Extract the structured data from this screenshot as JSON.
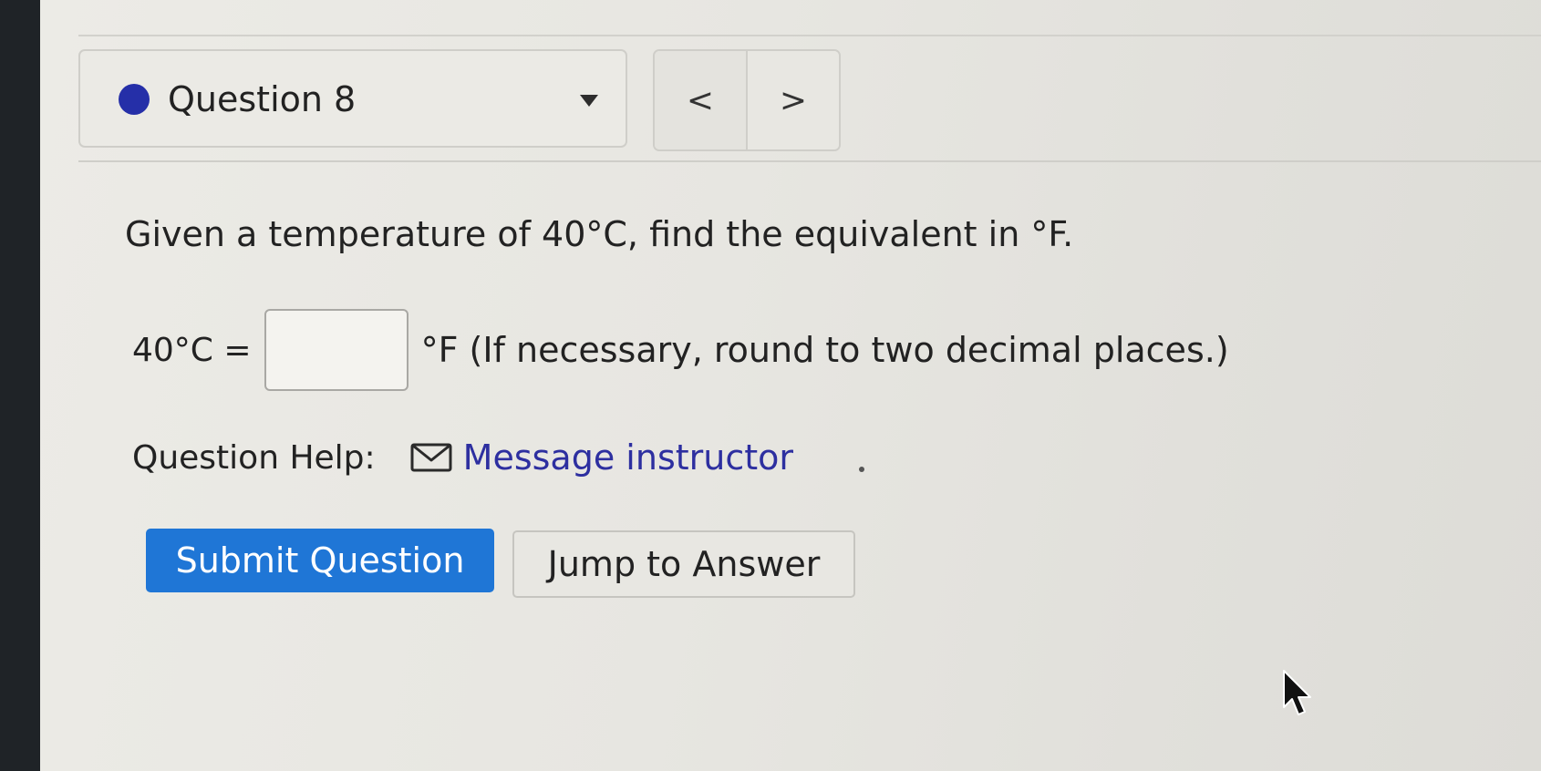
{
  "question_nav": {
    "label": "Question 8",
    "status_color": "#252fa8",
    "prev_label": "<",
    "next_label": ">"
  },
  "question": {
    "prompt": "Given a temperature of 40°C, find the equivalent in °F.",
    "answer_prefix": "40°C =",
    "answer_value": "",
    "answer_suffix": "°F (If necessary, round to two decimal places.)"
  },
  "help": {
    "label": "Question Help:",
    "link_icon": "mail-icon",
    "link_label": "Message instructor"
  },
  "actions": {
    "submit_label": "Submit Question",
    "jump_label": "Jump to Answer",
    "submit_color": "#1f76d6"
  }
}
